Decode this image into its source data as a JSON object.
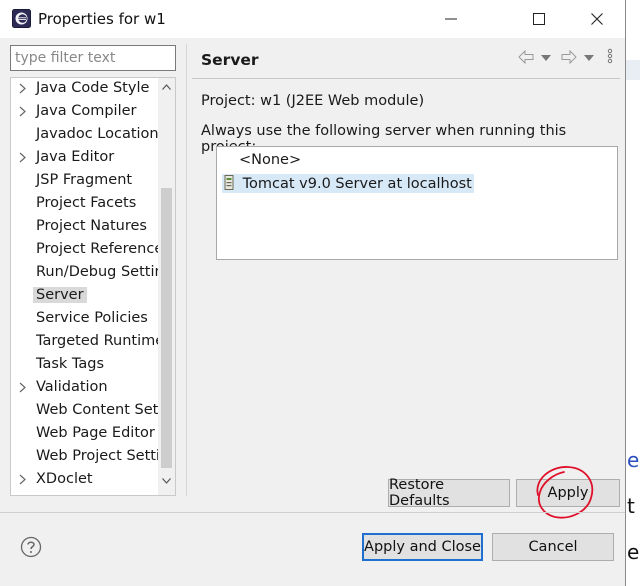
{
  "window": {
    "title": "Properties for w1"
  },
  "filter": {
    "placeholder": "type filter text"
  },
  "tree": {
    "items": [
      {
        "label": "Java Code Style",
        "expandable": true
      },
      {
        "label": "Java Compiler",
        "expandable": true
      },
      {
        "label": "Javadoc Location",
        "expandable": false
      },
      {
        "label": "Java Editor",
        "expandable": true
      },
      {
        "label": "JSP Fragment",
        "expandable": false
      },
      {
        "label": "Project Facets",
        "expandable": false
      },
      {
        "label": "Project Natures",
        "expandable": false
      },
      {
        "label": "Project References",
        "expandable": false
      },
      {
        "label": "Run/Debug Settings",
        "expandable": false
      },
      {
        "label": "Server",
        "expandable": false,
        "selected": true
      },
      {
        "label": "Service Policies",
        "expandable": false
      },
      {
        "label": "Targeted Runtimes",
        "expandable": false
      },
      {
        "label": "Task Tags",
        "expandable": false
      },
      {
        "label": "Validation",
        "expandable": true
      },
      {
        "label": "Web Content Settings",
        "expandable": false
      },
      {
        "label": "Web Page Editor",
        "expandable": false
      },
      {
        "label": "Web Project Settings",
        "expandable": false
      },
      {
        "label": "XDoclet",
        "expandable": true
      }
    ]
  },
  "page": {
    "title": "Server",
    "project_line": "Project: w1 (J2EE Web module)",
    "instruction": "Always use the following server when running this project:",
    "servers": [
      {
        "label": "<None>",
        "selected": false
      },
      {
        "label": "Tomcat v9.0 Server at localhost",
        "selected": true
      }
    ]
  },
  "buttons": {
    "restore_defaults": "Restore Defaults",
    "apply": "Apply",
    "apply_and_close": "Apply and Close",
    "cancel": "Cancel"
  },
  "colors": {
    "selection": "#d7e8f7",
    "default_button_border": "#1e6fd0",
    "annotation_circle": "#e0102a"
  },
  "icons": {
    "app": "eclipse-icon",
    "back": "back-arrow-icon",
    "forward": "forward-arrow-icon",
    "menu": "view-menu-icon",
    "help": "help-icon",
    "server": "server-icon"
  }
}
